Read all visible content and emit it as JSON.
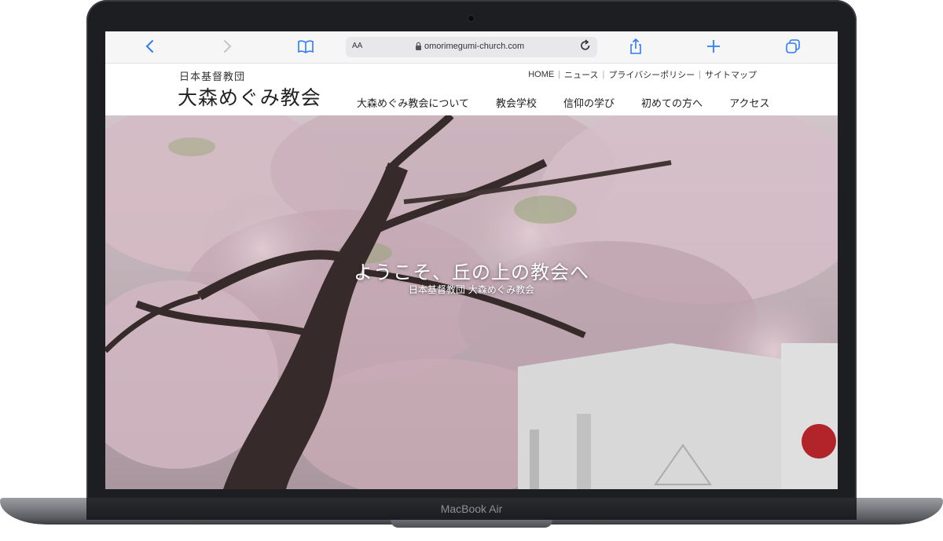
{
  "browser": {
    "text_size_label": "AA",
    "url": "omorimegumi-church.com"
  },
  "site": {
    "org_name": "日本基督教団",
    "title": "大森めぐみ教会",
    "utility_nav": [
      "HOME",
      "ニュース",
      "プライバシーポリシー",
      "サイトマップ"
    ],
    "main_nav": [
      "大森めぐみ教会について",
      "教会学校",
      "信仰の学び",
      "初めての方へ",
      "アクセス"
    ]
  },
  "hero": {
    "headline": "ようこそ、丘の上の教会へ",
    "subheadline": "日本基督教団 大森めぐみ教会"
  },
  "device": {
    "label": "MacBook Air"
  },
  "icons": {
    "back": "chevron-left-icon",
    "forward": "chevron-right-icon",
    "bookmarks": "book-icon",
    "lock": "lock-icon",
    "reload": "reload-icon",
    "share": "share-icon",
    "new_tab": "plus-icon",
    "tabs": "tabs-icon"
  },
  "colors": {
    "accent": "#2f7cf6",
    "sakura": "#e8c9d3",
    "laptop_bezel": "#1d1e21"
  }
}
